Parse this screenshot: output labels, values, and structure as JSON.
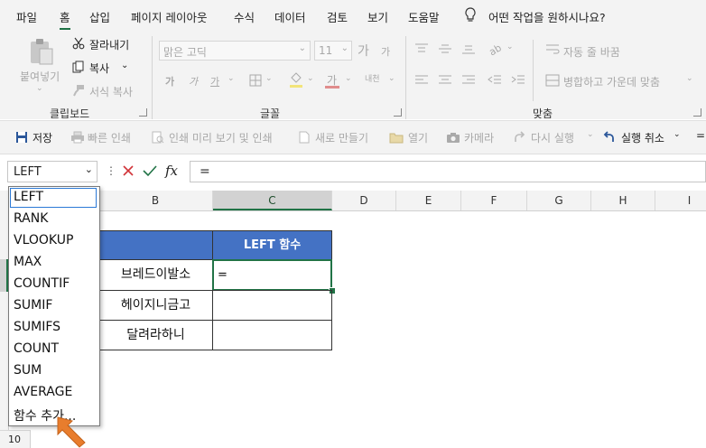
{
  "menu": {
    "items": [
      "파일",
      "홈",
      "삽입",
      "페이지 레이아웃",
      "수식",
      "데이터",
      "검토",
      "보기",
      "도움말"
    ],
    "active_index": 1,
    "tell_me": "어떤 작업을 원하시나요?"
  },
  "ribbon": {
    "clipboard": {
      "paste": "붙여넣기",
      "cut": "잘라내기",
      "copy": "복사",
      "format_painter": "서식 복사",
      "label": "클립보드"
    },
    "font": {
      "name": "맑은 고딕",
      "size": "11",
      "grow": "가",
      "shrink": "가",
      "bold": "가",
      "italic": "가",
      "underline": "가",
      "font_color": "가",
      "phonetic": "내천",
      "label": "글꼴"
    },
    "alignment": {
      "wrap_text": "자동 줄 바꿈",
      "merge_center": "병합하고 가운데 맞춤",
      "label": "맞춤"
    }
  },
  "qat": {
    "save": "저장",
    "quick_print": "빠른 인쇄",
    "print_preview": "인쇄 미리 보기 및 인쇄",
    "new": "새로 만들기",
    "open": "열기",
    "camera": "카메라",
    "redo": "다시 실행",
    "undo": "실행 취소"
  },
  "formula_bar": {
    "name_box": "LEFT",
    "fx": "fx",
    "content": "="
  },
  "columns": [
    "B",
    "C",
    "D",
    "E",
    "F",
    "G",
    "H",
    "I"
  ],
  "selected_column": "C",
  "row_headers": {
    "last_visible": "10"
  },
  "table": {
    "header_c": "LEFT 함수",
    "rows": [
      {
        "b": "브레드이발소",
        "c": "="
      },
      {
        "b": "헤이지니금고",
        "c": ""
      },
      {
        "b": "달려라하니",
        "c": ""
      }
    ],
    "header_color": "#4472c4"
  },
  "function_dropdown": {
    "items": [
      "LEFT",
      "RANK",
      "VLOOKUP",
      "MAX",
      "COUNTIF",
      "SUMIF",
      "SUMIFS",
      "COUNT",
      "SUM",
      "AVERAGE",
      "함수 추가..."
    ],
    "highlighted_index": 0
  },
  "colors": {
    "accent": "#217346",
    "selection": "#1e7145",
    "pointer": "#e87d2d"
  }
}
